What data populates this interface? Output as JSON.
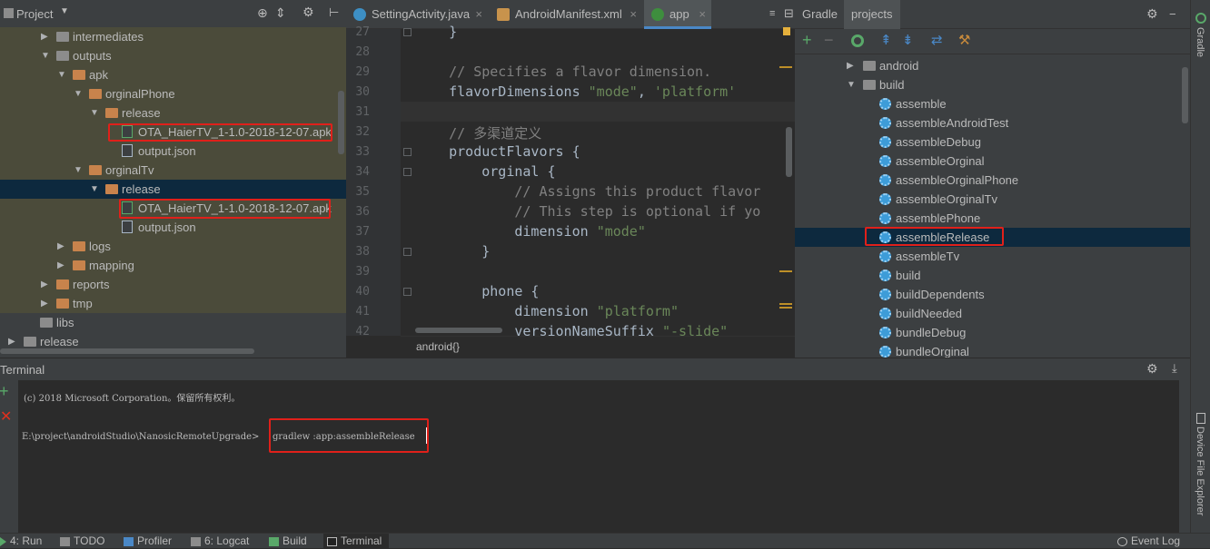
{
  "project": {
    "title": "Project",
    "tree": [
      {
        "label": "intermediates",
        "depth": 3,
        "kind": "folder-gray",
        "arrow": "right"
      },
      {
        "label": "outputs",
        "depth": 3,
        "kind": "folder-gray",
        "arrow": "down"
      },
      {
        "label": "apk",
        "depth": 4,
        "kind": "folder-orange",
        "arrow": "down"
      },
      {
        "label": "orginalPhone",
        "depth": 5,
        "kind": "folder-orange",
        "arrow": "down"
      },
      {
        "label": "release",
        "depth": 6,
        "kind": "folder-orange",
        "arrow": "down"
      },
      {
        "label": "OTA_HaierTV_1-1.0-2018-12-07.apk",
        "depth": 7,
        "kind": "apk"
      },
      {
        "label": "output.json",
        "depth": 7,
        "kind": "file"
      },
      {
        "label": "orginalTv",
        "depth": 5,
        "kind": "folder-orange",
        "arrow": "down"
      },
      {
        "label": "release",
        "depth": 6,
        "kind": "folder-orange",
        "arrow": "down"
      },
      {
        "label": "OTA_HaierTV_1-1.0-2018-12-07.apk",
        "depth": 7,
        "kind": "apk"
      },
      {
        "label": "output.json",
        "depth": 7,
        "kind": "file"
      },
      {
        "label": "logs",
        "depth": 4,
        "kind": "folder-orange",
        "arrow": "right"
      },
      {
        "label": "mapping",
        "depth": 4,
        "kind": "folder-orange",
        "arrow": "right"
      },
      {
        "label": "reports",
        "depth": 3,
        "kind": "folder-orange",
        "arrow": "right"
      },
      {
        "label": "tmp",
        "depth": 3,
        "kind": "folder-orange",
        "arrow": "right"
      },
      {
        "label": "libs",
        "depth": 2,
        "kind": "folder-gray"
      },
      {
        "label": "release",
        "depth": 1,
        "kind": "folder-gray",
        "arrow": "right"
      }
    ]
  },
  "editor": {
    "tabs": [
      "SettingActivity.java",
      "AndroidManifest.xml",
      "app"
    ],
    "breadcrumb": "android{}",
    "lines": [
      {
        "n": "27",
        "segs": [
          {
            "t": "    }",
            "c": ""
          }
        ]
      },
      {
        "n": "28",
        "segs": []
      },
      {
        "n": "29",
        "segs": [
          {
            "t": "    // Specifies a flavor dimension.",
            "c": "cmt"
          }
        ]
      },
      {
        "n": "30",
        "segs": [
          {
            "t": "    flavorDimensions ",
            "c": ""
          },
          {
            "t": "\"mode\"",
            "c": "str"
          },
          {
            "t": ", ",
            "c": ""
          },
          {
            "t": "'platform'",
            "c": "str"
          }
        ]
      },
      {
        "n": "31",
        "segs": []
      },
      {
        "n": "32",
        "segs": [
          {
            "t": "    // 多渠道定义",
            "c": "cmt"
          }
        ]
      },
      {
        "n": "33",
        "segs": [
          {
            "t": "    productFlavors {",
            "c": ""
          }
        ]
      },
      {
        "n": "34",
        "segs": [
          {
            "t": "        orginal {",
            "c": ""
          }
        ]
      },
      {
        "n": "35",
        "segs": [
          {
            "t": "            // Assigns this product flavor",
            "c": "cmt"
          }
        ]
      },
      {
        "n": "36",
        "segs": [
          {
            "t": "            // This step is optional if yo",
            "c": "cmt"
          }
        ]
      },
      {
        "n": "37",
        "segs": [
          {
            "t": "            dimension ",
            "c": ""
          },
          {
            "t": "\"mode\"",
            "c": "str"
          }
        ]
      },
      {
        "n": "38",
        "segs": [
          {
            "t": "        }",
            "c": ""
          }
        ]
      },
      {
        "n": "39",
        "segs": []
      },
      {
        "n": "40",
        "segs": [
          {
            "t": "        phone {",
            "c": ""
          }
        ]
      },
      {
        "n": "41",
        "segs": [
          {
            "t": "            dimension ",
            "c": ""
          },
          {
            "t": "\"platform\"",
            "c": "str"
          }
        ]
      },
      {
        "n": "42",
        "segs": [
          {
            "t": "            versionNameSuffix ",
            "c": ""
          },
          {
            "t": "\"-slide\"",
            "c": "str"
          }
        ]
      }
    ]
  },
  "gradle": {
    "title": "Gradle",
    "tab": "projects",
    "tree": [
      {
        "label": "android",
        "depth": 0,
        "kind": "folder",
        "arrow": "right"
      },
      {
        "label": "build",
        "depth": 0,
        "kind": "folder",
        "arrow": "down"
      },
      {
        "label": "assemble",
        "depth": 1,
        "kind": "task"
      },
      {
        "label": "assembleAndroidTest",
        "depth": 1,
        "kind": "task"
      },
      {
        "label": "assembleDebug",
        "depth": 1,
        "kind": "task"
      },
      {
        "label": "assembleOrginal",
        "depth": 1,
        "kind": "task"
      },
      {
        "label": "assembleOrginalPhone",
        "depth": 1,
        "kind": "task"
      },
      {
        "label": "assembleOrginalTv",
        "depth": 1,
        "kind": "task"
      },
      {
        "label": "assemblePhone",
        "depth": 1,
        "kind": "task"
      },
      {
        "label": "assembleRelease",
        "depth": 1,
        "kind": "task"
      },
      {
        "label": "assembleTv",
        "depth": 1,
        "kind": "task"
      },
      {
        "label": "build",
        "depth": 1,
        "kind": "task"
      },
      {
        "label": "buildDependents",
        "depth": 1,
        "kind": "task"
      },
      {
        "label": "buildNeeded",
        "depth": 1,
        "kind": "task"
      },
      {
        "label": "bundleDebug",
        "depth": 1,
        "kind": "task"
      },
      {
        "label": "bundleOrginal",
        "depth": 1,
        "kind": "task"
      }
    ],
    "side_label": "Gradle",
    "device_label": "Device File Explorer"
  },
  "terminal": {
    "title": "Terminal",
    "line1": "(c) 2018 Microsoft Corporation。保留所有权利。",
    "prompt": "E:\\project\\androidStudio\\NanosicRemoteUpgrade>",
    "command": "gradlew :app:assembleRelease"
  },
  "bottom": {
    "tabs": [
      "4: Run",
      "TODO",
      "Profiler",
      "6: Logcat",
      "Build",
      "Terminal"
    ],
    "event_log": "Event Log"
  },
  "colors": {
    "accent": "#4a88c7",
    "highlight_box": "#e0201a",
    "selection": "#0d293e"
  }
}
